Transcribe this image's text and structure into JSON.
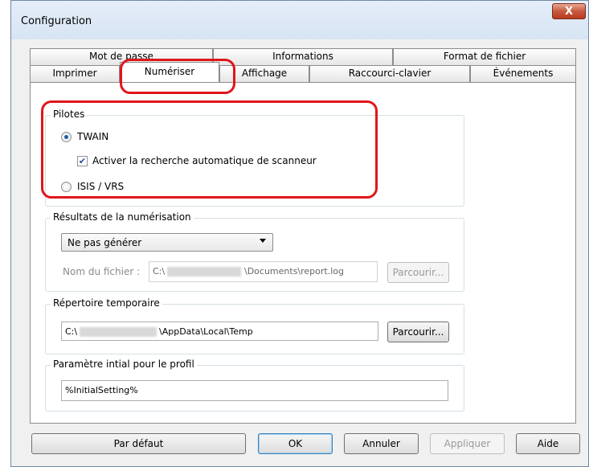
{
  "window": {
    "title": "Configuration",
    "close_label": "X"
  },
  "tabs": {
    "back_row": [
      "Mot de passe",
      "Informations",
      "Format de fichier"
    ],
    "front_row": [
      "Imprimer",
      "Numériser",
      "Affichage",
      "Raccourci-clavier",
      "Événements"
    ],
    "active": "Numériser"
  },
  "pilotes": {
    "title": "Pilotes",
    "twain_label": "TWAIN",
    "twain_selected": true,
    "auto_search_label": "Activer la recherche automatique de scanneur",
    "auto_search_checked": true,
    "isis_label": "ISIS / VRS",
    "isis_selected": false
  },
  "resultats": {
    "title": "Résultats de la numérisation",
    "select_value": "Ne pas générer",
    "filename_label": "Nom du fichier :",
    "filename_prefix": "C:\\",
    "filename_suffix": "\\Documents\\report.log",
    "browse_label": "Parcourir..."
  },
  "repertoire": {
    "title": "Répertoire temporaire",
    "path_prefix": "C:\\",
    "path_suffix": "\\AppData\\Local\\Temp",
    "browse_label": "Parcourir..."
  },
  "profil": {
    "title": "Paramètre intial pour le profil",
    "value": "%InitialSetting%"
  },
  "buttons": {
    "default_label": "Par défaut",
    "ok_label": "OK",
    "cancel_label": "Annuler",
    "apply_label": "Appliquer",
    "help_label": "Aide"
  },
  "colors": {
    "highlight": "#e0161b",
    "radio_dot": "#1e5aa5"
  }
}
